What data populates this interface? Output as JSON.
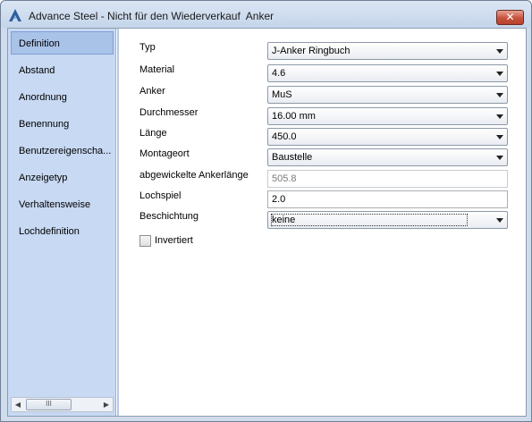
{
  "window": {
    "title": "Advance Steel - Nicht für den Wiederverkauf  Anker",
    "close_symbol": "✕",
    "icon": "advance-steel-logo-icon"
  },
  "sidebar": {
    "items": [
      {
        "label": "Definition",
        "selected": true
      },
      {
        "label": "Abstand"
      },
      {
        "label": "Anordnung"
      },
      {
        "label": "Benennung"
      },
      {
        "label": "Benutzereigenscha..."
      },
      {
        "label": "Anzeigetyp"
      },
      {
        "label": "Verhaltensweise"
      },
      {
        "label": "Lochdefinition"
      }
    ],
    "scrollbar": {
      "left_arrow": "◀",
      "right_arrow": "▶",
      "thumb_grip": "III"
    }
  },
  "form": {
    "typ": {
      "label": "Typ",
      "value": "J-Anker Ringbuch"
    },
    "material": {
      "label": "Material",
      "value": "4.6"
    },
    "anker": {
      "label": "Anker",
      "value": "MuS"
    },
    "durchmesser": {
      "label": "Durchmesser",
      "value": "16.00 mm"
    },
    "laenge": {
      "label": "Länge",
      "value": "450.0"
    },
    "montageort": {
      "label": "Montageort",
      "value": "Baustelle"
    },
    "abgewickelte_ankerlaenge": {
      "label": "abgewickelte Ankerlänge",
      "value": "505.8"
    },
    "lochspiel": {
      "label": "Lochspiel",
      "value": "2.0"
    },
    "beschichtung": {
      "label": "Beschichtung",
      "value": "keine"
    },
    "invertiert": {
      "label": "Invertiert",
      "checked": false
    }
  },
  "colors": {
    "sidebar_bg": "#c7d9f3",
    "selected_item": "#a9c2e8",
    "close_button": "#c7533d"
  }
}
